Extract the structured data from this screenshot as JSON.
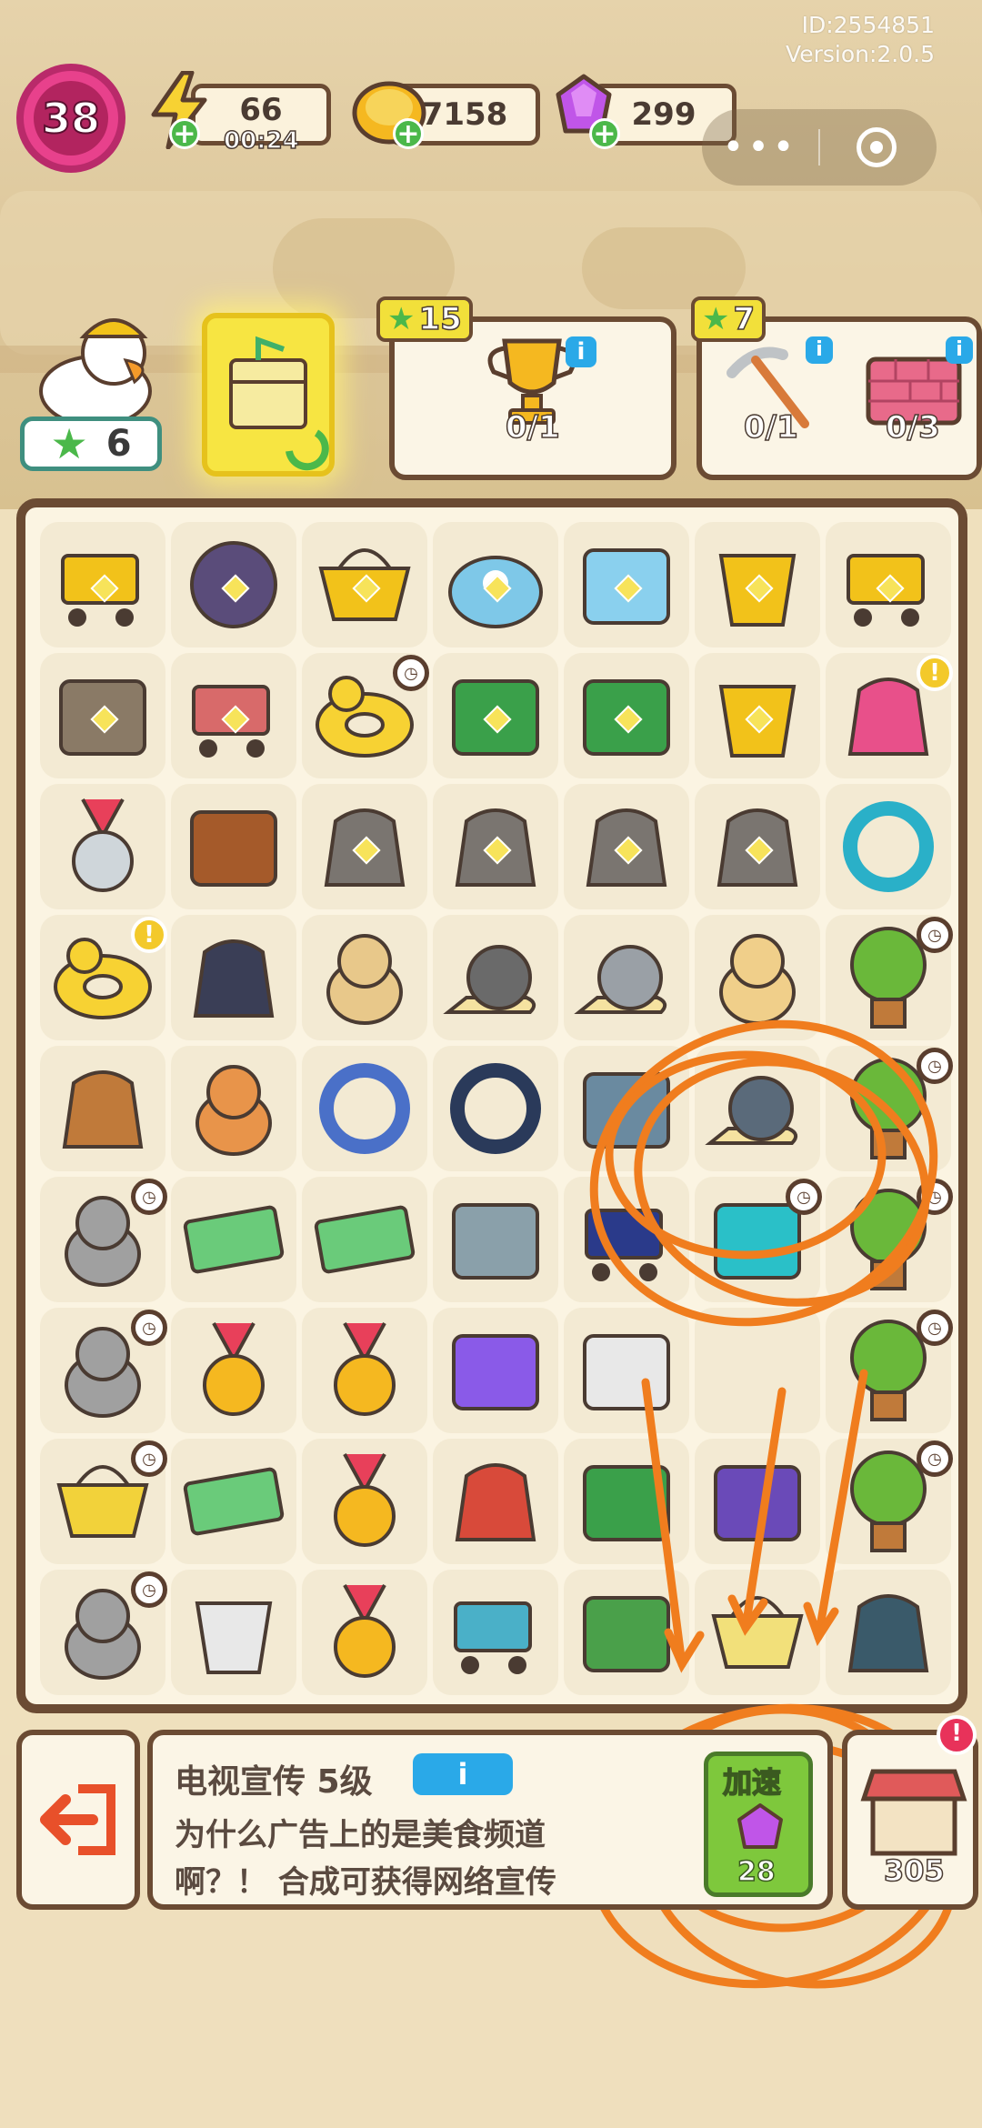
{
  "header": {
    "id_text": "ID:2554851",
    "version_text": "Version:2.0.5"
  },
  "player": {
    "level": "38"
  },
  "resources": {
    "energy": {
      "value": "66",
      "timer": "00:24",
      "icon": "lightning-icon",
      "color": "#f2c21a"
    },
    "coins": {
      "value": "7158",
      "icon": "coin-icon",
      "color": "#f5b820"
    },
    "gems": {
      "value": "299",
      "icon": "gem-icon",
      "color": "#c055e8"
    }
  },
  "miniprogram": {
    "more_icon": "more-dots-icon",
    "close_icon": "target-icon"
  },
  "helper": {
    "stars": "6"
  },
  "quests": [
    {
      "reward": "15",
      "progress": "0/1",
      "item": "trophy"
    },
    {
      "reward": "7",
      "progress": "0/1",
      "item": "pickaxe"
    },
    {
      "reward": "",
      "progress": "0/3",
      "item": "bricks"
    }
  ],
  "selected_item": {
    "title": "电视宣传 5级",
    "description": "为什么广告上的是美食频道啊？！ 合成可获得网络宣传",
    "speed_label": "加速",
    "speed_cost": "28",
    "shop_partial": "305"
  },
  "colors": {
    "accent_orange": "#f07d1e",
    "board_border": "#6b4b33",
    "info_blue": "#2aa9e8"
  }
}
